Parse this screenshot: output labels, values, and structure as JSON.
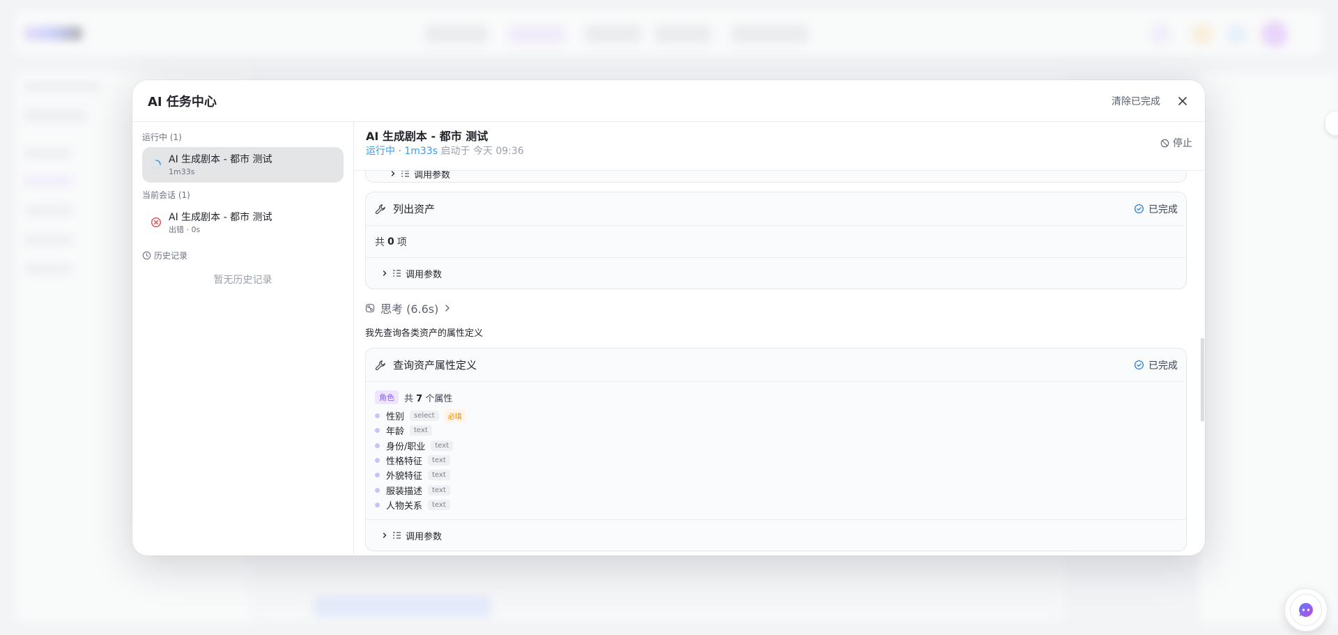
{
  "modal": {
    "title": "AI 任务中心",
    "clear_label": "清除已完成"
  },
  "left": {
    "running_label": "运行中 (1)",
    "running_task": {
      "name": "AI 生成剧本 - 都市 测试",
      "sub": "1m33s"
    },
    "session_label": "当前会话 (1)",
    "session_task": {
      "name": "AI 生成剧本 - 都市 测试",
      "sub": "出错 · 0s"
    },
    "history_label": "历史记录",
    "history_empty": "暂无历史记录"
  },
  "detail": {
    "title": "AI 生成剧本 - 都市 测试",
    "status": "运行中 · 1m33s",
    "started": "启动于 今天 09:36",
    "stop_label": "停止",
    "params_label": "调用参数",
    "card1": {
      "title": "列出资产",
      "status": "已完成",
      "summary_prefix": "共",
      "summary_count": "0",
      "summary_suffix": "项"
    },
    "thinking": "思考 (6.6s)",
    "note": "我先查询各类资产的属性定义",
    "card2": {
      "title": "查询资产属性定义",
      "status": "已完成",
      "role_tag": "角色",
      "count_prefix": "共",
      "count": "7",
      "count_suffix": "个属性",
      "attributes": [
        {
          "name": "性别",
          "type": "select",
          "required": "必填"
        },
        {
          "name": "年龄",
          "type": "text"
        },
        {
          "name": "身份/职业",
          "type": "text"
        },
        {
          "name": "性格特征",
          "type": "text"
        },
        {
          "name": "外貌特征",
          "type": "text"
        },
        {
          "name": "服装描述",
          "type": "text"
        },
        {
          "name": "人物关系",
          "type": "text"
        }
      ]
    }
  },
  "colors": {
    "running_blue": "#3b9ae8",
    "error_red": "#e5484d",
    "role_purple": "#8b5cf6",
    "required_orange": "#f08c00"
  },
  "icons": [
    "close-icon",
    "spinner-icon",
    "error-icon",
    "clock-icon",
    "stop-icon",
    "wrench-icon",
    "check-circle-icon",
    "chevron-right-icon",
    "params-icon",
    "thinking-icon",
    "chat-bot-icon"
  ]
}
